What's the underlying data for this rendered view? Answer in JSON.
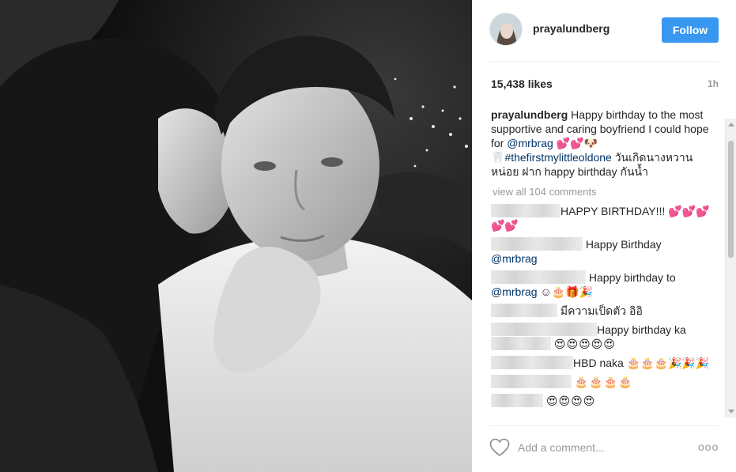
{
  "post": {
    "username": "prayalundberg",
    "follow_label": "Follow",
    "likes": "15,438 likes",
    "time": "1h",
    "caption": {
      "user": "prayalundberg",
      "text_1": " Happy birthday to the most supportive and caring boyfriend I could hope for ",
      "mention": "@mrbrag",
      "emoji_1": " 💕💕🐶",
      "hashtag_prefix": "🦷",
      "hashtag": "#thefirstmylittleoldone",
      "text_2": " วันเกิดนางหวานหน่อย ฝาก happy birthday กันน้ำ"
    },
    "view_all": "view all 104 comments",
    "comments": [
      {
        "text": "HAPPY BIRTHDAY!!! 💕💕💕💕💕"
      },
      {
        "text": "Happy Birthday",
        "mention": "@mrbrag"
      },
      {
        "text": "Happy birthday to",
        "mention": "@mrbrag",
        "tail": " ☺🎂🎁🎉"
      },
      {
        "text": "มีความเป็ดตัว อิอิ"
      },
      {
        "text": "Happy birthday ka",
        "tail": "😍😍😍😍😍"
      },
      {
        "text": "HBD naka 🎂🎂🎂🎉🎉🎉"
      },
      {
        "text": "🎂🎂🎂🎂"
      },
      {
        "text": "😍😍😍😍"
      }
    ],
    "add_comment_placeholder": "Add a comment...",
    "more_label": "ooo"
  },
  "colors": {
    "follow_bg": "#3897f0",
    "link": "#003569",
    "muted": "#999999"
  },
  "icons": {
    "heart": "heart-outline-icon",
    "more": "more-options-icon"
  }
}
